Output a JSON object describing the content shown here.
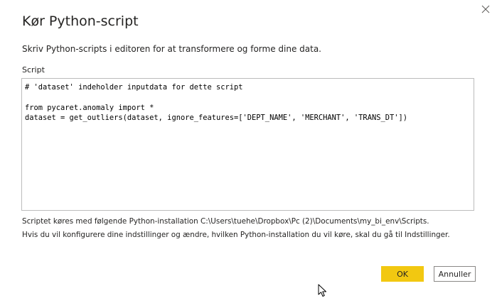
{
  "dialog": {
    "title": "Kør Python-script",
    "description": "Skriv Python-scripts i editoren for at transformere og forme dine data.",
    "close_icon": "close-icon"
  },
  "script": {
    "label": "Script",
    "code_lines": [
      "# 'dataset' indeholder inputdata for dette script",
      "",
      "from pycaret.anomaly import *",
      "dataset = get_outliers(dataset, ignore_features=['DEPT_NAME', 'MERCHANT', 'TRANS_DT'])"
    ]
  },
  "info": {
    "installation": "Scriptet køres med følgende Python-installation C:\\Users\\tuehe\\Dropbox\\Pc (2)\\Documents\\my_bi_env\\Scripts.",
    "settings_hint": "Hvis du vil konfigurere dine indstillinger og ændre, hvilken Python-installation du vil køre, skal du gå til Indstillinger."
  },
  "buttons": {
    "ok_label": "OK",
    "cancel_label": "Annuller"
  },
  "colors": {
    "primary_button": "#f2c811",
    "text": "#252423",
    "editor_border": "#bcbcbc"
  }
}
